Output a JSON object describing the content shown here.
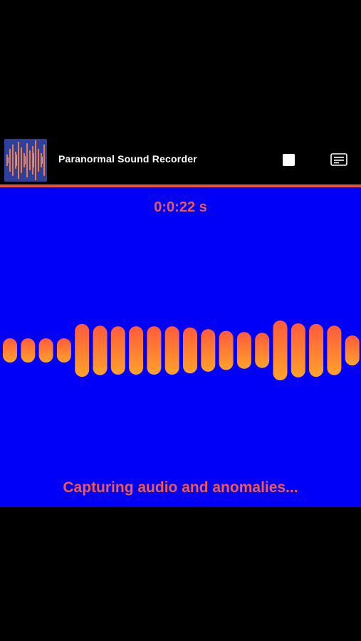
{
  "header": {
    "app_title": "Paranormal Sound Recorder",
    "thumbnail_icon": "waveform-thumbnail-icon",
    "stop_icon": "stop-icon",
    "menu_icon": "menu-list-icon"
  },
  "recorder": {
    "elapsed": "0:0:22 s",
    "status": "Capturing audio and anomalies...",
    "levels": [
      0.38,
      0.38,
      0.38,
      0.38,
      0.88,
      0.82,
      0.8,
      0.8,
      0.8,
      0.8,
      0.76,
      0.7,
      0.64,
      0.6,
      0.57,
      1.0,
      0.9,
      0.88,
      0.82,
      0.48
    ]
  },
  "colors": {
    "background": "#0000f8",
    "accent": "#f05a4a",
    "bar_top": "#ff5a3c",
    "bar_bottom": "#ffa22a"
  }
}
